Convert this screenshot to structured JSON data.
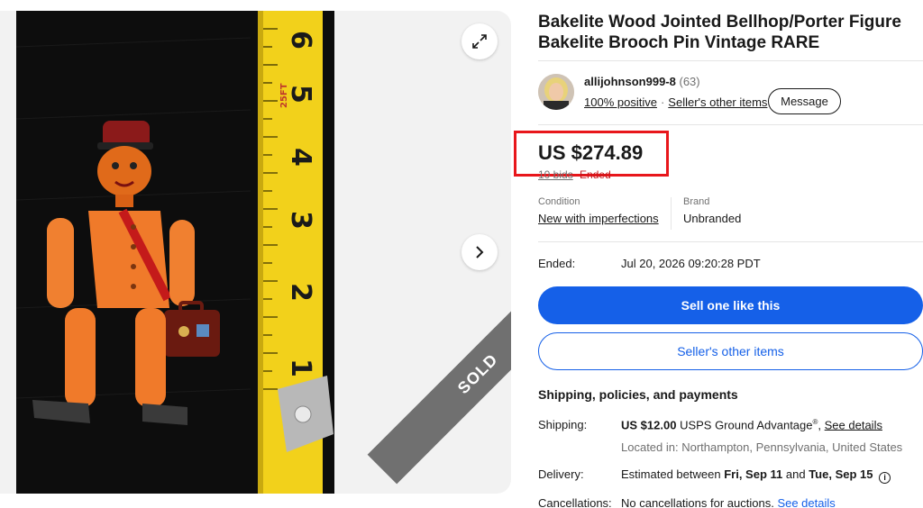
{
  "listing": {
    "title": "Bakelite Wood Jointed Bellhop/Porter Figure Bakelite Brooch Pin Vintage RARE",
    "sold_badge": "SOLD"
  },
  "seller": {
    "name": "allijohnson999-8",
    "feedback_count": "(63)",
    "positive": "100% positive",
    "other_items": "Seller's other items",
    "message_button": "Message"
  },
  "price": {
    "amount": "US $274.89",
    "bids": "10 bids",
    "status": "Ended"
  },
  "condition": {
    "label": "Condition",
    "value": "New with imperfections"
  },
  "brand": {
    "label": "Brand",
    "value": "Unbranded"
  },
  "ended": {
    "label": "Ended:",
    "value": "Jul 20, 2026 09:20:28 PDT"
  },
  "actions": {
    "sell_one": "Sell one like this",
    "other_items": "Seller's other items"
  },
  "shipping": {
    "heading": "Shipping, policies, and payments",
    "shipping_label": "Shipping:",
    "shipping_price": "US $12.00",
    "shipping_service": "USPS Ground Advantage",
    "registered_mark": "®",
    "shipping_link": "See details",
    "location": "Located in: Northampton, Pennsylvania, United States",
    "delivery_label": "Delivery:",
    "delivery_prefix": "Estimated between",
    "delivery_start": "Fri, Sep 11",
    "delivery_and": "and",
    "delivery_end": "Tue, Sep 15",
    "info_glyph": "i",
    "cancel_label": "Cancellations:",
    "cancel_text": "No cancellations for auctions.",
    "cancel_link": "See details"
  },
  "colors": {
    "primary": "#1560e8",
    "highlight_box": "#e8161b",
    "sold_ribbon": "#707070"
  },
  "tape_numbers": [
    "6",
    "5",
    "4",
    "3",
    "2",
    "1"
  ],
  "tape_brand": "25FT"
}
